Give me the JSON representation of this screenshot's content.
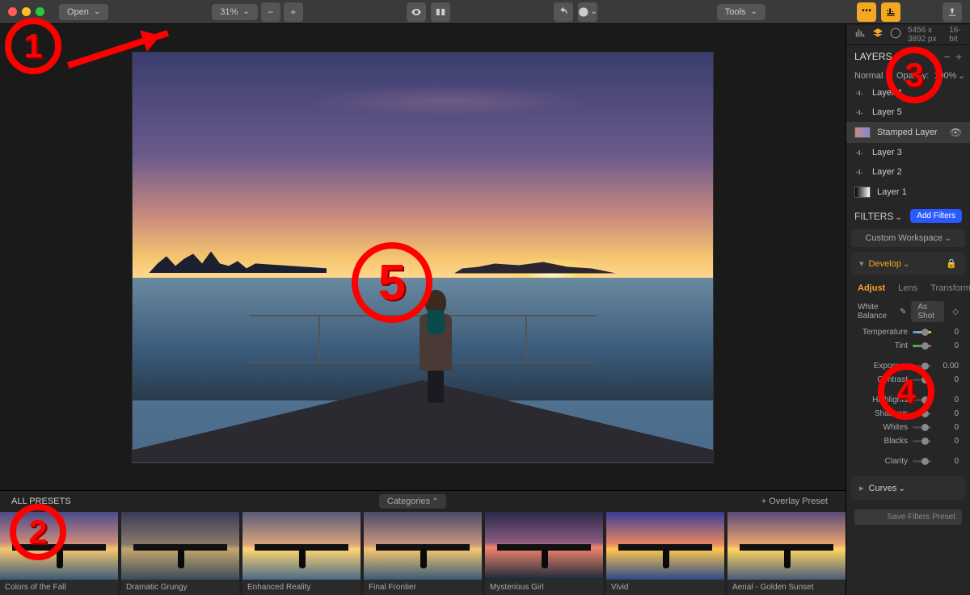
{
  "toolbar": {
    "open": "Open",
    "zoom": "31%",
    "tools": "Tools"
  },
  "meta": {
    "dimensions": "5456 x 3892 px",
    "depth": "16-bit"
  },
  "layers": {
    "title": "LAYERS",
    "blend_mode": "Normal",
    "opacity_label": "Opacity:",
    "opacity_value": "100%",
    "items": [
      {
        "name": "Layer 4",
        "type": "adj"
      },
      {
        "name": "Layer 5",
        "type": "adj"
      },
      {
        "name": "Stamped Layer",
        "type": "img",
        "selected": true
      },
      {
        "name": "Layer 3",
        "type": "adj"
      },
      {
        "name": "Layer 2",
        "type": "adj"
      },
      {
        "name": "Layer 1",
        "type": "grad"
      }
    ]
  },
  "filters": {
    "title": "FILTERS",
    "add": "Add Filters",
    "workspace": "Custom Workspace",
    "develop": "Develop",
    "tabs": [
      "Adjust",
      "Lens",
      "Transform"
    ],
    "wb_label": "White Balance",
    "wb_value": "As Shot",
    "sliders": [
      {
        "label": "Temperature",
        "val": "0",
        "gradient": "temp"
      },
      {
        "label": "Tint",
        "val": "0",
        "gradient": "tint"
      },
      {
        "label": "Exposure",
        "val": "0.00"
      },
      {
        "label": "Contrast",
        "val": "0"
      },
      {
        "label": "Highlights",
        "val": "0"
      },
      {
        "label": "Shadows",
        "val": "0"
      },
      {
        "label": "Whites",
        "val": "0"
      },
      {
        "label": "Blacks",
        "val": "0"
      },
      {
        "label": "Clarity",
        "val": "0"
      }
    ],
    "curves": "Curves",
    "save_preset": "Save Filters Preset"
  },
  "presets": {
    "title": "ALL PRESETS",
    "categories": "Categories",
    "overlay": "+ Overlay Preset",
    "items": [
      {
        "label": "Colors of the Fall",
        "bg": "linear-gradient(180deg,#4a4a8a 0%,#c88a7e 45%,#f5c56e 55%,#3a5a7a 100%)"
      },
      {
        "label": "Dramatic Grungy",
        "bg": "linear-gradient(180deg,#3a3a5a 0%,#8a7a6a 48%,#c5a56e 55%,#3a4a5a 100%)"
      },
      {
        "label": "Enhanced Reality",
        "bg": "linear-gradient(180deg,#5a5a7a 0%,#d8a57e 48%,#ffd570 55%,#4a6a8a 100%)"
      },
      {
        "label": "Final Frontier",
        "bg": "linear-gradient(180deg,#4a4a6a 0%,#c8957e 48%,#f5c56e 55%,#3a5a7a 100%)"
      },
      {
        "label": "Mysterious Girl",
        "bg": "linear-gradient(180deg,#2a2a4a 0%,#8a5a7e 45%,#f5856e 52%,#1a2a3a 100%)"
      },
      {
        "label": "Vivid",
        "bg": "linear-gradient(180deg,#3a3a9a 0%,#e88a5e 48%,#ffc550 55%,#2a4a8a 100%)"
      },
      {
        "label": "Aerial - Golden Sunset",
        "bg": "linear-gradient(180deg,#5a4a7a 0%,#e8a56e 48%,#ffd560 55%,#4a5a7a 100%)"
      }
    ]
  },
  "annotations": {
    "1": "1",
    "2": "2",
    "3": "3",
    "4": "4",
    "5": "5"
  }
}
